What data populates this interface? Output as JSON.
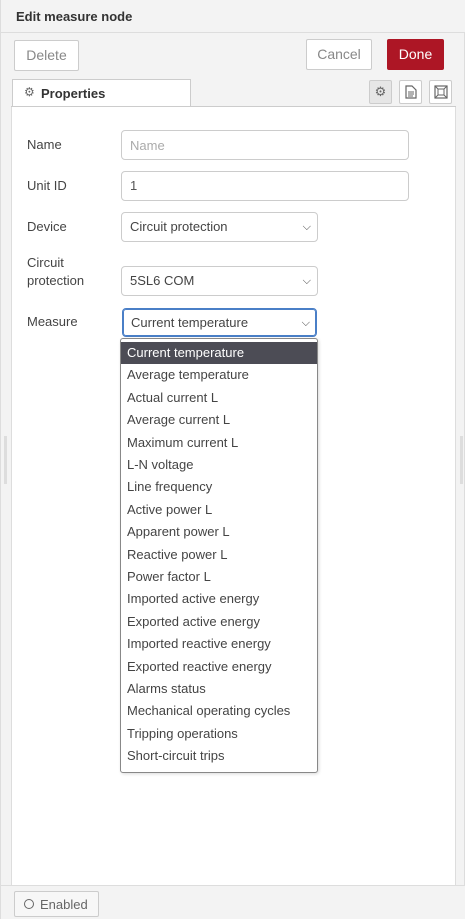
{
  "header": {
    "title": "Edit measure node"
  },
  "toolbar": {
    "delete_label": "Delete",
    "cancel_label": "Cancel",
    "done_label": "Done"
  },
  "tabs": {
    "properties_label": "Properties"
  },
  "form": {
    "name": {
      "label": "Name",
      "value": "",
      "placeholder": "Name"
    },
    "unit_id": {
      "label": "Unit ID",
      "value": "1"
    },
    "device": {
      "label": "Device",
      "value": "Circuit protection"
    },
    "circuit_protection": {
      "label_line1": "Circuit",
      "label_line2": "protection",
      "value": "5SL6 COM"
    },
    "measure": {
      "label": "Measure",
      "value": "Current temperature"
    }
  },
  "dropdown": {
    "options": [
      "Current temperature",
      "Average temperature",
      "Actual current L",
      "Average current L",
      "Maximum current L",
      "L-N voltage",
      "Line frequency",
      "Active power L",
      "Apparent power L",
      "Reactive power L",
      "Power factor L",
      "Imported active energy",
      "Exported active energy",
      "Imported reactive energy",
      "Exported reactive energy",
      "Alarms status",
      "Mechanical operating cycles",
      "Tripping operations",
      "Short-circuit trips"
    ],
    "selected_index": 0
  },
  "footer": {
    "enabled_label": "Enabled"
  },
  "colors": {
    "primary": "#ad1625",
    "selected_option_bg": "#4c4c55",
    "focus_border": "#4a7fc7"
  }
}
